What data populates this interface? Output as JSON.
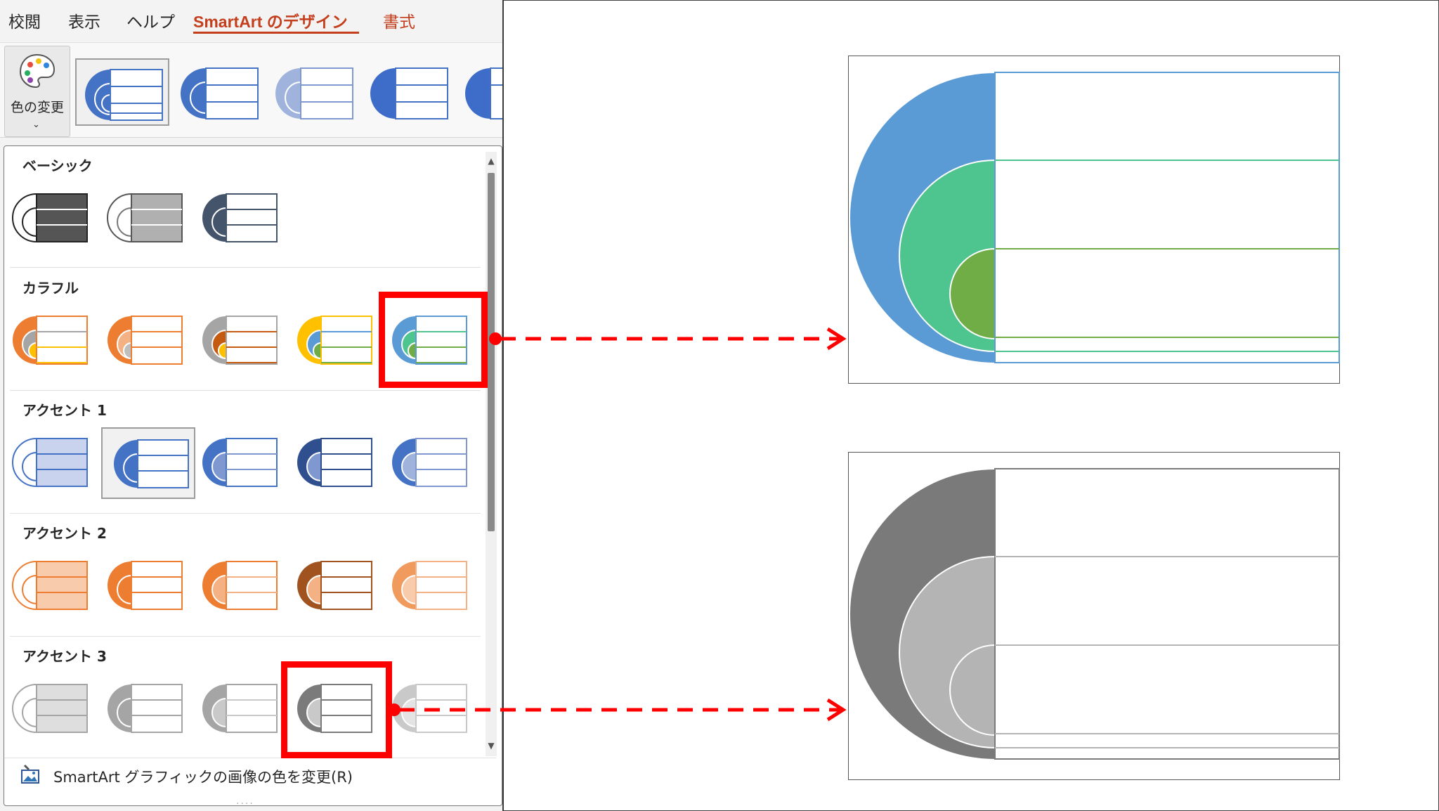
{
  "tabs": [
    {
      "label": "校閲"
    },
    {
      "label": "表示"
    },
    {
      "label": "ヘルプ"
    },
    {
      "label": "SmartArt のデザイン",
      "active": true
    },
    {
      "label": "書式"
    }
  ],
  "ribbon": {
    "color_change_label": "色の変更",
    "chevron": "⌄"
  },
  "dropdown": {
    "categories": [
      {
        "label": "ベーシック"
      },
      {
        "label": "カラフル"
      },
      {
        "label": "アクセント 1"
      },
      {
        "label": "アクセント 2"
      },
      {
        "label": "アクセント 3"
      }
    ],
    "recolor_label": "SmartArt グラフィックの画像の色を変更(R)",
    "grip": "....",
    "scroll_up": "▲",
    "scroll_down": "▼"
  },
  "colors": {
    "accent_red": "#ff0000",
    "tab_active": "#c43e1c",
    "blue": "#5b9bd5",
    "teal": "#4ec48f",
    "green": "#70ad47",
    "gray_dark": "#7a7a7a",
    "gray_light": "#b4b4b4"
  }
}
